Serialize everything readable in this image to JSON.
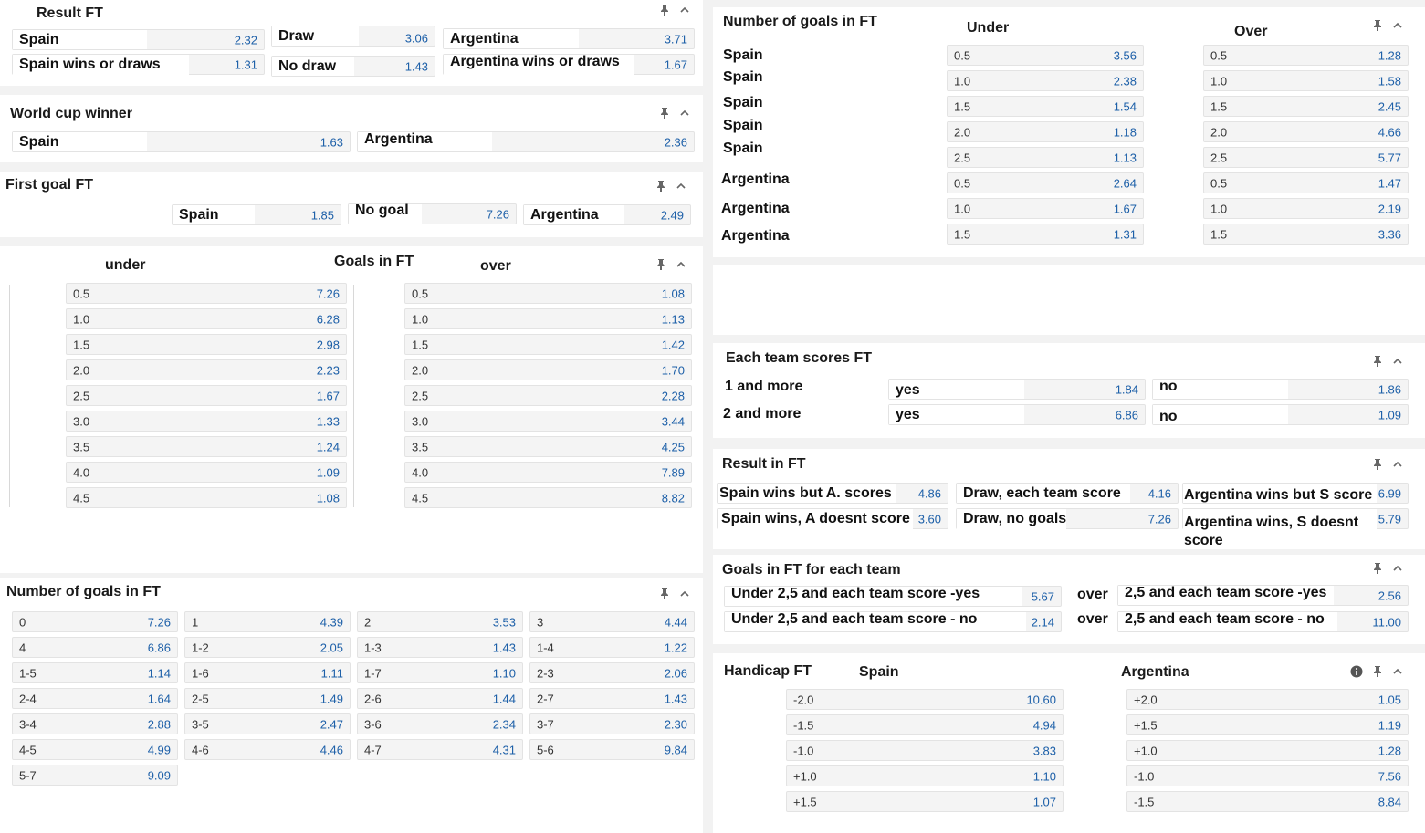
{
  "icons": {
    "pin": "pin-icon",
    "collapse": "chevron-up-icon",
    "info": "info-icon"
  },
  "colors": {
    "odds_value": "#1c5fa8",
    "cell_bg": "#f4f4f4",
    "page_bg": "#f2f2f2"
  },
  "result_ft": {
    "title": "Result FT",
    "options": [
      {
        "label": "Spain",
        "odds": "2.32"
      },
      {
        "label": "Draw",
        "odds": "3.06"
      },
      {
        "label": "Argentina",
        "odds": "3.71"
      },
      {
        "label": "Spain wins or draws",
        "odds": "1.31"
      },
      {
        "label": "No draw",
        "odds": "1.43"
      },
      {
        "label": "Argentina wins or draws",
        "odds": "1.67"
      }
    ]
  },
  "world_cup_winner": {
    "title": "World cup winner",
    "options": [
      {
        "label": "Spain",
        "odds": "1.63"
      },
      {
        "label": "Argentina",
        "odds": "2.36"
      }
    ]
  },
  "first_goal": {
    "title": "First goal  FT",
    "options": [
      {
        "label": "Spain",
        "odds": "1.85"
      },
      {
        "label": "No goal",
        "odds": "7.26"
      },
      {
        "label": "Argentina",
        "odds": "2.49"
      }
    ]
  },
  "goals_ft": {
    "title": "Goals in FT",
    "under_header": "under",
    "over_header": "over",
    "under": [
      {
        "line": "0.5",
        "odds": "7.26"
      },
      {
        "line": "1.0",
        "odds": "6.28"
      },
      {
        "line": "1.5",
        "odds": "2.98"
      },
      {
        "line": "2.0",
        "odds": "2.23"
      },
      {
        "line": "2.5",
        "odds": "1.67"
      },
      {
        "line": "3.0",
        "odds": "1.33"
      },
      {
        "line": "3.5",
        "odds": "1.24"
      },
      {
        "line": "4.0",
        "odds": "1.09"
      },
      {
        "line": "4.5",
        "odds": "1.08"
      }
    ],
    "over": [
      {
        "line": "0.5",
        "odds": "1.08"
      },
      {
        "line": "1.0",
        "odds": "1.13"
      },
      {
        "line": "1.5",
        "odds": "1.42"
      },
      {
        "line": "2.0",
        "odds": "1.70"
      },
      {
        "line": "2.5",
        "odds": "2.28"
      },
      {
        "line": "3.0",
        "odds": "3.44"
      },
      {
        "line": "3.5",
        "odds": "4.25"
      },
      {
        "line": "4.0",
        "odds": "7.89"
      },
      {
        "line": "4.5",
        "odds": "8.82"
      }
    ]
  },
  "number_goals_ft": {
    "title": "Number of goals in FT",
    "cells": [
      {
        "label": "0",
        "odds": "7.26"
      },
      {
        "label": "1",
        "odds": "4.39"
      },
      {
        "label": "2",
        "odds": "3.53"
      },
      {
        "label": "3",
        "odds": "4.44"
      },
      {
        "label": "4",
        "odds": "6.86"
      },
      {
        "label": "1-2",
        "odds": "2.05"
      },
      {
        "label": "1-3",
        "odds": "1.43"
      },
      {
        "label": "1-4",
        "odds": "1.22"
      },
      {
        "label": "1-5",
        "odds": "1.14"
      },
      {
        "label": "1-6",
        "odds": "1.11"
      },
      {
        "label": "1-7",
        "odds": "1.10"
      },
      {
        "label": "2-3",
        "odds": "2.06"
      },
      {
        "label": "2-4",
        "odds": "1.64"
      },
      {
        "label": "2-5",
        "odds": "1.49"
      },
      {
        "label": "2-6",
        "odds": "1.44"
      },
      {
        "label": "2-7",
        "odds": "1.43"
      },
      {
        "label": "3-4",
        "odds": "2.88"
      },
      {
        "label": "3-5",
        "odds": "2.47"
      },
      {
        "label": "3-6",
        "odds": "2.34"
      },
      {
        "label": "3-7",
        "odds": "2.30"
      },
      {
        "label": "4-5",
        "odds": "4.99"
      },
      {
        "label": "4-6",
        "odds": "4.46"
      },
      {
        "label": "4-7",
        "odds": "4.31"
      },
      {
        "label": "5-6",
        "odds": "9.84"
      },
      {
        "label": "5-7",
        "odds": "9.09"
      }
    ]
  },
  "team_goals_ft": {
    "title": "Number of goals in FT",
    "under_header": "Under",
    "over_header": "Over",
    "rows": [
      {
        "team": "Spain",
        "line": "0.5",
        "under": "3.56",
        "over": "1.28"
      },
      {
        "team": "Spain",
        "line": "1.0",
        "under": "2.38",
        "over": "1.58"
      },
      {
        "team": "Spain",
        "line": "1.5",
        "under": "1.54",
        "over": "2.45"
      },
      {
        "team": "Spain",
        "line": "2.0",
        "under": "1.18",
        "over": "4.66"
      },
      {
        "team": "Spain",
        "line": "2.5",
        "under": "1.13",
        "over": "5.77"
      },
      {
        "team": "Argentina",
        "line": "0.5",
        "under": "2.64",
        "over": "1.47"
      },
      {
        "team": "Argentina",
        "line": "1.0",
        "under": "1.67",
        "over": "2.19"
      },
      {
        "team": "Argentina",
        "line": "1.5",
        "under": "1.31",
        "over": "3.36"
      }
    ]
  },
  "each_team_scores": {
    "title": "Each team scores FT",
    "rows": [
      {
        "label": "1 and more",
        "yes_label": "yes",
        "yes_odds": "1.84",
        "no_label": "no",
        "no_odds": "1.86"
      },
      {
        "label": "2 and more",
        "yes_label": "yes",
        "yes_odds": "6.86",
        "no_label": "no",
        "no_odds": "1.09"
      }
    ]
  },
  "result_in_ft": {
    "title": "Result in FT",
    "options": [
      {
        "label": "Spain wins but A. scores",
        "odds": "4.86"
      },
      {
        "label": "Draw, each team score",
        "odds": "4.16"
      },
      {
        "label": "Argentina wins but S score",
        "odds": "6.99"
      },
      {
        "label": "Spain wins, A doesnt score",
        "odds": "3.60"
      },
      {
        "label": "Draw, no goals",
        "odds": "7.26"
      },
      {
        "label": "Argentina wins, S doesnt score",
        "odds": "5.79"
      }
    ]
  },
  "goals_each_team": {
    "title": "Goals in FT for each team",
    "rows": [
      {
        "under_label": "Under 2,5 and each team score -yes",
        "under_odds": "5.67",
        "over_word": "over",
        "over_label": "2,5 and each team score -yes",
        "over_odds": "2.56"
      },
      {
        "under_label": "Under 2,5 and each team score - no",
        "under_odds": "2.14",
        "over_word": "over",
        "over_label": "2,5 and each team score - no",
        "over_odds": "11.00"
      }
    ]
  },
  "handicap_ft": {
    "title": "Handicap FT",
    "spain_header": "Spain",
    "argentina_header": "Argentina",
    "spain": [
      {
        "line": "-2.0",
        "odds": "10.60"
      },
      {
        "line": "-1.5",
        "odds": "4.94"
      },
      {
        "line": "-1.0",
        "odds": "3.83"
      },
      {
        "line": "+1.0",
        "odds": "1.10"
      },
      {
        "line": "+1.5",
        "odds": "1.07"
      }
    ],
    "argentina": [
      {
        "line": "+2.0",
        "odds": "1.05"
      },
      {
        "line": "+1.5",
        "odds": "1.19"
      },
      {
        "line": "+1.0",
        "odds": "1.28"
      },
      {
        "line": "-1.0",
        "odds": "7.56"
      },
      {
        "line": "-1.5",
        "odds": "8.84"
      }
    ]
  }
}
